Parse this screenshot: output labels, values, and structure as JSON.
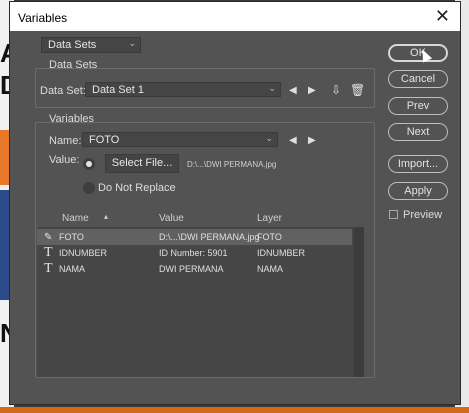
{
  "window": {
    "title": "Variables",
    "close_glyph": "✕"
  },
  "top_dropdown": {
    "value": "Data Sets"
  },
  "data_sets_group": {
    "legend": "Data Sets",
    "label": "Data Set:",
    "value": "Data Set 1"
  },
  "variables_group": {
    "legend": "Variables",
    "name_label": "Name:",
    "name_value": "FOTO",
    "value_label": "Value:",
    "select_file_label": "Select File...",
    "file_path": "D:\\...\\DWI PERMANA.jpg",
    "do_not_replace_label": "Do Not Replace"
  },
  "table": {
    "headers": [
      "Name",
      "Value",
      "Layer"
    ],
    "rows": [
      {
        "name": "FOTO",
        "value": "D:\\...\\DWI PERMANA.jpg",
        "layer": "FOTO",
        "icon": "image-icon",
        "selected": true
      },
      {
        "name": "IDNUMBER",
        "value": "ID Number: 5901",
        "layer": "IDNUMBER",
        "icon": "text-icon",
        "selected": false
      },
      {
        "name": "NAMA",
        "value": "DWI PERMANA",
        "layer": "NAMA",
        "icon": "text-icon",
        "selected": false
      }
    ]
  },
  "buttons": {
    "ok": "OK",
    "cancel": "Cancel",
    "prev": "Prev",
    "next": "Next",
    "import": "Import...",
    "apply": "Apply"
  },
  "preview": {
    "label": "Preview",
    "checked": false
  },
  "background_letters": [
    "A",
    "D",
    "N"
  ]
}
